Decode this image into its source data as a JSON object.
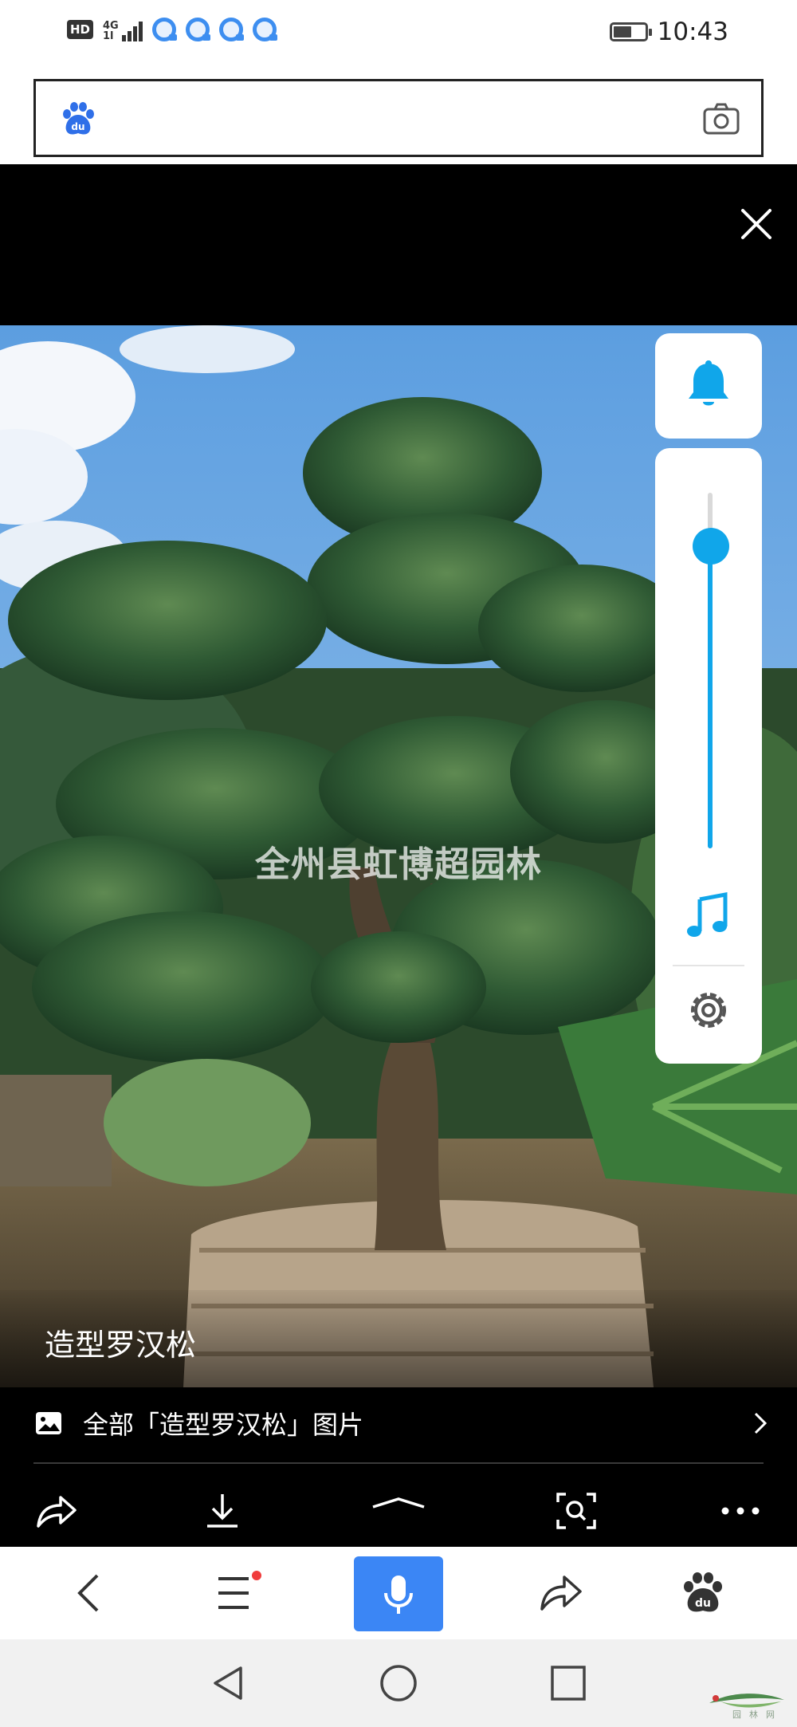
{
  "status_bar": {
    "hd_badge": "HD",
    "network_label": "4G",
    "network_sub": "1l",
    "notification_icons": [
      "qq-notification-icon",
      "qq-notification-icon",
      "qq-notification-icon",
      "qq-notification-icon"
    ],
    "battery_level": 0.6,
    "time": "10:43"
  },
  "search": {
    "logo_icon": "baidu-paw-icon",
    "logo_text": "du",
    "value": "",
    "camera_icon": "camera-icon"
  },
  "viewer": {
    "close_icon": "close-icon",
    "watermark": "全州县虹博超园林",
    "caption": "造型罗汉松",
    "all_images_link": "全部「造型罗汉松」图片",
    "tools": [
      "share-icon",
      "download-icon",
      "expand-up-icon",
      "image-search-icon",
      "more-icon"
    ]
  },
  "floating_widget": {
    "bell_icon": "bell-icon",
    "volume_level": 0.85,
    "music_icon": "music-note-icon",
    "settings_icon": "gear-icon"
  },
  "browser_toolbar": {
    "items": [
      "back-icon",
      "menu-icon",
      "microphone-icon",
      "share-icon",
      "baidu-home-icon"
    ],
    "menu_has_notification": true,
    "paw_text": "du"
  },
  "system_nav": {
    "items": [
      "nav-back-icon",
      "nav-home-icon",
      "nav-recents-icon"
    ],
    "corner_text": "园林网"
  },
  "colors": {
    "accent_blue": "#10a6ea",
    "mic_blue": "#3b86f5",
    "baidu_blue": "#2f6fe8",
    "notification_red": "#f03c3c"
  }
}
